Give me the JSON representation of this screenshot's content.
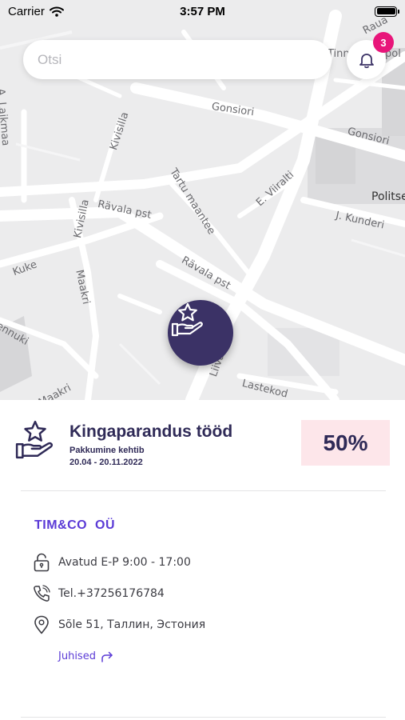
{
  "status_bar": {
    "carrier": "Carrier",
    "time": "3:57 PM"
  },
  "search": {
    "placeholder": "Otsi"
  },
  "notifications": {
    "count": "3"
  },
  "map": {
    "streets": [
      "Raua",
      "Tinn",
      "pol",
      "Gonsiori",
      "Gonsiori",
      "A. Laikmaa",
      "Kivisilla",
      "Tartu maantee",
      "E. Viiralti",
      "Politse",
      "J. Kunderi",
      "Rävala pst",
      "Kivisilla",
      "Kuke",
      "Rävala pst",
      "Maakri",
      "ennuki",
      "Liivalaia",
      "Lastekod",
      "Maakri"
    ]
  },
  "deal": {
    "title": "Kingaparandus tööd",
    "subtitle": "Pakkumine kehtib",
    "dates": "20.04 - 20.11.2022",
    "discount": "50%"
  },
  "company": {
    "name": "TIM&CO  OÜ",
    "hours": "Avatud E-P 9:00 - 17:00",
    "phone": "Tel.+37256176784",
    "address": "Sõle 51, Таллин, Эстония",
    "directions_label": "Juhised"
  },
  "colors": {
    "brand": "#3b3266",
    "accent": "#5b3bd6",
    "badge": "#e8157a",
    "discount_bg": "#fde6ea"
  }
}
